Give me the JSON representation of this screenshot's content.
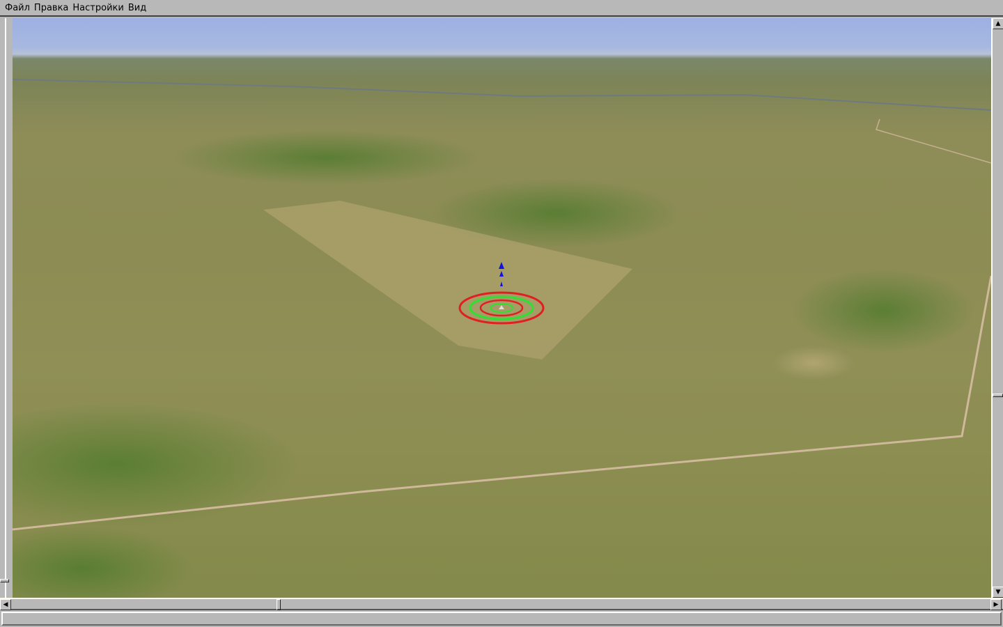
{
  "menu": {
    "items": [
      "Файл",
      "Правка",
      "Настройки",
      "Вид"
    ]
  },
  "scrollbars": {
    "vertical_position": 0.66,
    "horizontal_position": 0.27
  },
  "colors": {
    "chrome": "#b8b8b8",
    "sky": "#9db0e2",
    "terrain": "#8c8c54",
    "gizmo_red": "#e02020",
    "gizmo_green": "#30e030",
    "gizmo_blue": "#1010e0"
  },
  "status": {
    "text": ""
  }
}
